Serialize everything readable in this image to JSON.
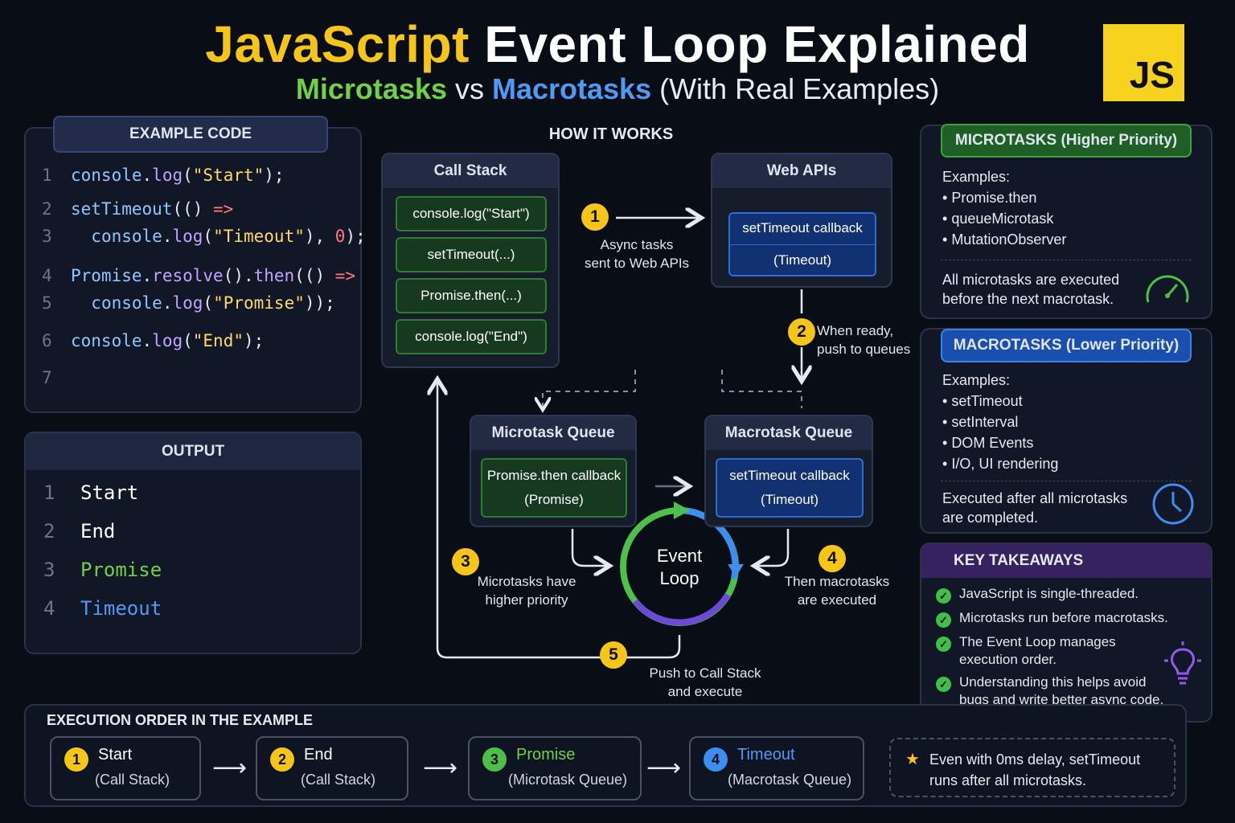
{
  "title": {
    "part1": "JavaScript",
    "part2": "Event Loop Explained"
  },
  "subtitle": {
    "micro": "Microtasks",
    "vs": "vs",
    "macro": "Macrotasks",
    "rest": "(With Real Examples)"
  },
  "logo_text": "JS",
  "example_code": {
    "header": "EXAMPLE CODE",
    "lines": [
      {
        "n": "1"
      },
      {
        "n": "2"
      },
      {
        "n": "3"
      },
      {
        "n": "4"
      },
      {
        "n": "5"
      },
      {
        "n": "6"
      },
      {
        "n": "7"
      }
    ]
  },
  "output": {
    "header": "OUTPUT",
    "lines": [
      {
        "n": "1",
        "text": "Start",
        "color": "#ffffff"
      },
      {
        "n": "2",
        "text": "End",
        "color": "#ffffff"
      },
      {
        "n": "3",
        "text": "Promise",
        "color": "#6fd04a"
      },
      {
        "n": "4",
        "text": "Timeout",
        "color": "#4d9bf5"
      }
    ]
  },
  "how_it_works": {
    "heading": "HOW IT WORKS",
    "call_stack": {
      "title": "Call Stack",
      "items": [
        "console.log(\"Start\")",
        "setTimeout(...)",
        "Promise.then(...)",
        "console.log(\"End\")"
      ]
    },
    "web_apis": {
      "title": "Web APIs",
      "item_line1": "setTimeout callback",
      "item_line2": "(Timeout)"
    },
    "microtask_queue": {
      "title": "Microtask Queue",
      "item_line1": "Promise.then callback",
      "item_line2": "(Promise)"
    },
    "macrotask_queue": {
      "title": "Macrotask Queue",
      "item_line1": "setTimeout callback",
      "item_line2": "(Timeout)"
    },
    "event_loop": {
      "line1": "Event",
      "line2": "Loop"
    },
    "steps": [
      {
        "n": "1",
        "line1": "Async tasks",
        "line2": "sent to Web APIs"
      },
      {
        "n": "2",
        "line1": "When ready,",
        "line2": "push to queues"
      },
      {
        "n": "3",
        "line1": "Microtasks have",
        "line2": "higher priority"
      },
      {
        "n": "4",
        "line1": "Then macrotasks",
        "line2": "are executed"
      },
      {
        "n": "5",
        "line1": "Push to Call Stack",
        "line2": "and execute"
      }
    ]
  },
  "microtasks_panel": {
    "header": "MICROTASKS (Higher Priority)",
    "examples_label": "Examples:",
    "examples": [
      "Promise.then",
      "queueMicrotask",
      "MutationObserver"
    ],
    "note_line1": "All microtasks are executed",
    "note_line2": "before the next macrotask.",
    "icon": "speedometer-icon",
    "accent": "#2f7a36"
  },
  "macrotasks_panel": {
    "header": "MACROTASKS (Lower Priority)",
    "examples_label": "Examples:",
    "examples": [
      "setTimeout",
      "setInterval",
      "DOM Events",
      "I/O, UI rendering"
    ],
    "note_line1": "Executed after all microtasks",
    "note_line2": "are completed.",
    "icon": "clock-icon",
    "accent": "#2f6bd1"
  },
  "key_takeaways": {
    "header": "KEY TAKEAWAYS",
    "items": [
      {
        "line1": "JavaScript is single-threaded.",
        "line2": ""
      },
      {
        "line1": "Microtasks run before macrotasks.",
        "line2": ""
      },
      {
        "line1": "The Event Loop manages",
        "line2": "execution order."
      },
      {
        "line1": "Understanding this helps avoid",
        "line2": "bugs and write better async code."
      }
    ],
    "icon": "lightbulb-icon"
  },
  "execution_order": {
    "heading": "EXECUTION ORDER IN THE EXAMPLE",
    "steps": [
      {
        "n": "1",
        "title": "Start",
        "sub": "(Call Stack)",
        "badge": "#f5c518",
        "color": "#ffffff"
      },
      {
        "n": "2",
        "title": "End",
        "sub": "(Call Stack)",
        "badge": "#f5c518",
        "color": "#ffffff"
      },
      {
        "n": "3",
        "title": "Promise",
        "sub": "(Microtask Queue)",
        "badge": "#4cc04a",
        "color": "#6fd04a"
      },
      {
        "n": "4",
        "title": "Timeout",
        "sub": "(Macrotask Queue)",
        "badge": "#3b8ff0",
        "color": "#4d9bf5"
      }
    ],
    "note_line1": "Even with 0ms delay, setTimeout",
    "note_line2": "runs after all microtasks.",
    "note_icon": "star-icon"
  }
}
